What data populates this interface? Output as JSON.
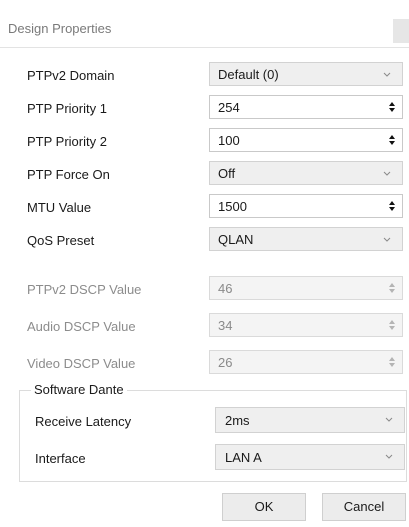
{
  "panel": {
    "title": "Design Properties"
  },
  "rows": [
    {
      "label": "PTPv2 Domain",
      "value": "Default (0)",
      "control": "dropdown",
      "enabled": true
    },
    {
      "label": "PTP Priority 1",
      "value": "254",
      "control": "spinner",
      "enabled": true
    },
    {
      "label": "PTP Priority 2",
      "value": "100",
      "control": "spinner",
      "enabled": true
    },
    {
      "label": "PTP Force On",
      "value": "Off",
      "control": "dropdown",
      "enabled": true
    },
    {
      "label": "MTU Value",
      "value": "1500",
      "control": "spinner",
      "enabled": true
    },
    {
      "label": "QoS Preset",
      "value": "QLAN",
      "control": "dropdown",
      "enabled": true
    },
    {
      "label": "PTPv2 DSCP Value",
      "value": "46",
      "control": "spinner",
      "enabled": false
    },
    {
      "label": "Audio DSCP Value",
      "value": "34",
      "control": "spinner",
      "enabled": false
    },
    {
      "label": "Video DSCP Value",
      "value": "26",
      "control": "spinner",
      "enabled": false
    }
  ],
  "software_dante": {
    "title": "Software Dante",
    "receive_latency": {
      "label": "Receive Latency",
      "value": "2ms"
    },
    "interface": {
      "label": "Interface",
      "value": "LAN A"
    }
  },
  "buttons": {
    "ok": "OK",
    "cancel": "Cancel"
  },
  "icons": {
    "dropdown": "chevron-down-icon",
    "spinner": "spin-arrows-icon"
  },
  "colors": {
    "label": "#1a1a1a",
    "disabled_label": "#8c8c8c",
    "border": "#c9c9c9"
  }
}
